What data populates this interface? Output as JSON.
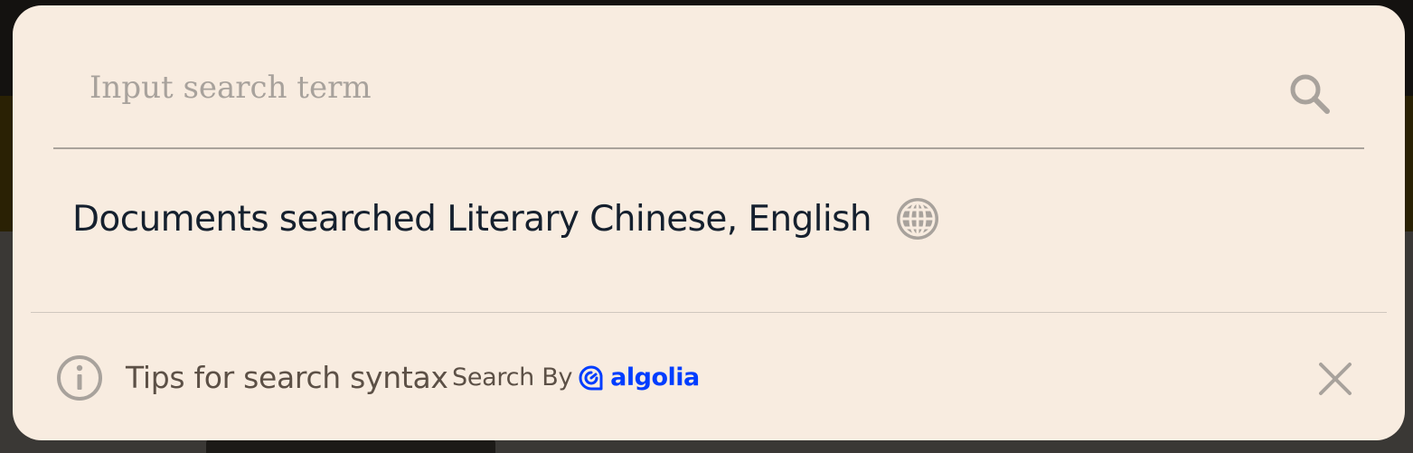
{
  "search": {
    "placeholder": "Input search term",
    "value": "",
    "submit_icon": "search-icon"
  },
  "documents": {
    "prefix": "Documents searched",
    "languages": "Literary Chinese, English",
    "language_icon": "globe-icon"
  },
  "footer": {
    "tips_icon": "info-icon",
    "tips_label": "Tips for search syntax",
    "search_by_label": "Search By",
    "provider_name": "algolia",
    "close_icon": "close-icon"
  },
  "colors": {
    "modal_background": "#f8ece0",
    "text_primary": "#15202e",
    "text_muted": "#5c5046",
    "icon_gray": "#a8a29c",
    "algolia_blue": "#003dff"
  }
}
